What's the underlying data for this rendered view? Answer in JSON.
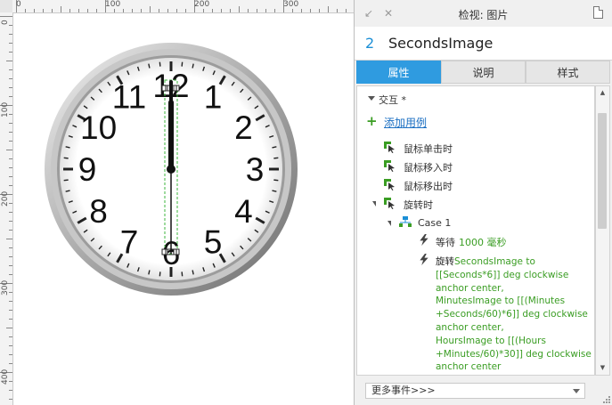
{
  "rulers": {
    "top_labels": [
      "0",
      "100",
      "200",
      "300"
    ],
    "left_labels": [
      "0",
      "100",
      "200",
      "300",
      "400"
    ]
  },
  "clock": {
    "numerals": [
      "12",
      "1",
      "2",
      "3",
      "4",
      "5",
      "6",
      "7",
      "8",
      "9",
      "10",
      "11"
    ],
    "time_shown": "12:00:30",
    "face_color": "#ffffff",
    "rim_color": "#a8a8a8",
    "hand_color": "#111111",
    "selection_color": "#3cb43c"
  },
  "panel": {
    "title": "检视: 图片",
    "widget_index": "2",
    "widget_name": "SecondsImage",
    "tabs": [
      {
        "label": "属性",
        "active": true
      },
      {
        "label": "说明",
        "active": false
      },
      {
        "label": "样式",
        "active": false
      }
    ],
    "section_label": "交互 *",
    "add_case": "添加用例",
    "events": [
      {
        "label": "鼠标单击时"
      },
      {
        "label": "鼠标移入时"
      },
      {
        "label": "鼠标移出时"
      },
      {
        "label": "旋转时"
      }
    ],
    "case_label": "Case 1",
    "wait_action": {
      "label": "等待",
      "value": "1000 毫秒"
    },
    "rotate_action": {
      "label": "旋转",
      "lines": [
        "SecondsImage to",
        "[[Seconds*6]] deg clockwise",
        "anchor center,",
        "MinutesImage to [[(Minutes",
        "+Seconds/60)*6]] deg clockwise",
        "anchor center,",
        "HoursImage to [[(Hours",
        "+Minutes/60)*30]] deg clockwise",
        "anchor center"
      ]
    },
    "more_events": "更多事件>>>",
    "accent_color": "#2f9be0",
    "action_color": "#3a9d23"
  }
}
